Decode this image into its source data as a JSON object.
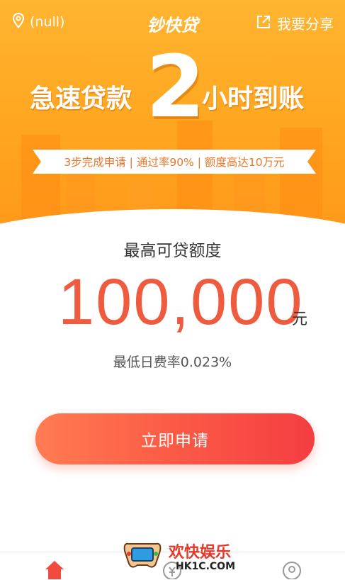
{
  "header": {
    "location_text": "(null)",
    "app_title": "钞快贷",
    "share_label": "我要分享"
  },
  "banner": {
    "headline_left": "急速贷款",
    "headline_number": "2",
    "headline_right": "小时到账",
    "ribbon_text": "3步完成申请 | 通过率90% | 额度高达10万元"
  },
  "loan": {
    "limit_label": "最高可贷额度",
    "amount": "100,000",
    "unit": "元",
    "rate_text": "最低日费率0.023%"
  },
  "actions": {
    "apply_label": "立即申请"
  },
  "watermark": {
    "title": "欢快娱乐",
    "url": "HK1C.COM"
  },
  "colors": {
    "banner": "#ffa51f",
    "accent": "#ef5b3f",
    "button_start": "#ff7c52",
    "button_end": "#f43d41"
  },
  "icons": [
    "location-icon",
    "share-icon",
    "home-icon",
    "loan-icon",
    "profile-icon"
  ]
}
